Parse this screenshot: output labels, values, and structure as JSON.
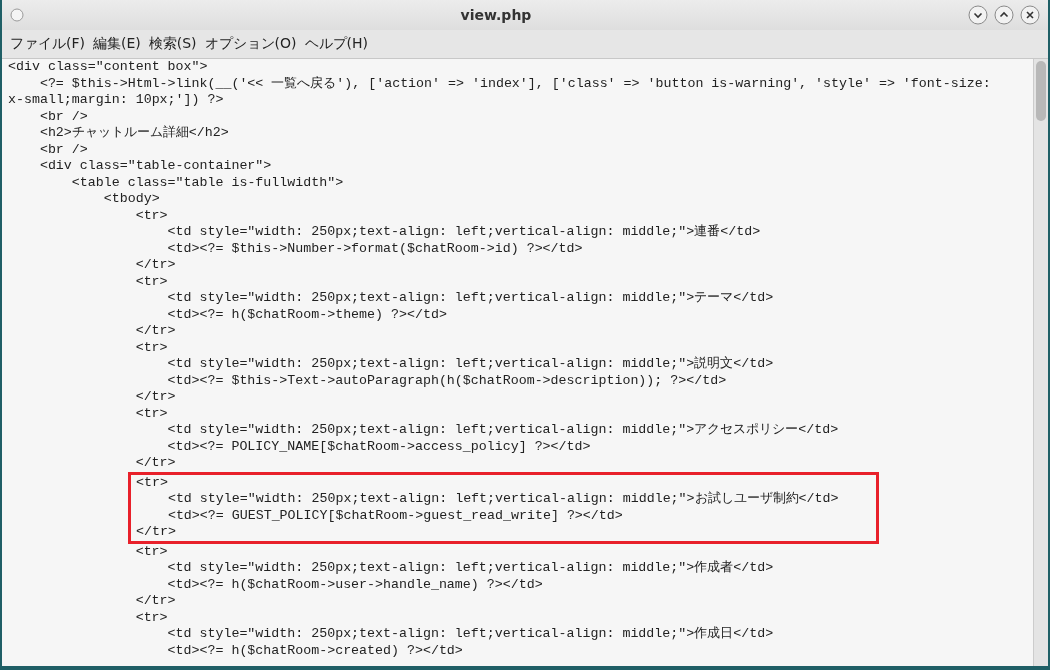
{
  "window": {
    "title": "view.php"
  },
  "menu": [
    "ファイル(F)",
    "編集(E)",
    "検索(S)",
    "オプション(O)",
    "ヘルプ(H)"
  ],
  "editor": {
    "lines": [
      {
        "text": "<div class=\"content box\">",
        "boxed": false
      },
      {
        "text": "    <?= $this->Html->link(__('<< 一覧へ戻る'), ['action' => 'index'], ['class' => 'button is-warning', 'style' => 'font-size: x-small;margin: 10px;']) ?>",
        "boxed": false
      },
      {
        "text": "    <br />",
        "boxed": false
      },
      {
        "text": "    <h2>チャットルーム詳細</h2>",
        "boxed": false
      },
      {
        "text": "    <br />",
        "boxed": false
      },
      {
        "text": "    <div class=\"table-container\">",
        "boxed": false
      },
      {
        "text": "        <table class=\"table is-fullwidth\">",
        "boxed": false
      },
      {
        "text": "            <tbody>",
        "boxed": false
      },
      {
        "text": "                <tr>",
        "boxed": false
      },
      {
        "text": "                    <td style=\"width: 250px;text-align: left;vertical-align: middle;\">連番</td>",
        "boxed": false
      },
      {
        "text": "                    <td><?= $this->Number->format($chatRoom->id) ?></td>",
        "boxed": false
      },
      {
        "text": "                </tr>",
        "boxed": false
      },
      {
        "text": "                <tr>",
        "boxed": false
      },
      {
        "text": "                    <td style=\"width: 250px;text-align: left;vertical-align: middle;\">テーマ</td>",
        "boxed": false
      },
      {
        "text": "                    <td><?= h($chatRoom->theme) ?></td>",
        "boxed": false
      },
      {
        "text": "                </tr>",
        "boxed": false
      },
      {
        "text": "                <tr>",
        "boxed": false
      },
      {
        "text": "                    <td style=\"width: 250px;text-align: left;vertical-align: middle;\">説明文</td>",
        "boxed": false
      },
      {
        "text": "                    <td><?= $this->Text->autoParagraph(h($chatRoom->description)); ?></td>",
        "boxed": false
      },
      {
        "text": "                </tr>",
        "boxed": false
      },
      {
        "text": "                <tr>",
        "boxed": false
      },
      {
        "text": "                    <td style=\"width: 250px;text-align: left;vertical-align: middle;\">アクセスポリシー</td>",
        "boxed": false
      },
      {
        "text": "                    <td><?= POLICY_NAME[$chatRoom->access_policy] ?></td>",
        "boxed": false
      },
      {
        "text": "                </tr>",
        "boxed": false
      },
      {
        "text": "                <tr>",
        "boxed": true
      },
      {
        "text": "                    <td style=\"width: 250px;text-align: left;vertical-align: middle;\">お試しユーザ制約</td>",
        "boxed": true
      },
      {
        "text": "                    <td><?= GUEST_POLICY[$chatRoom->guest_read_write] ?></td>",
        "boxed": true
      },
      {
        "text": "                </tr>",
        "boxed": true
      },
      {
        "text": "                <tr>",
        "boxed": false
      },
      {
        "text": "                    <td style=\"width: 250px;text-align: left;vertical-align: middle;\">作成者</td>",
        "boxed": false
      },
      {
        "text": "                    <td><?= h($chatRoom->user->handle_name) ?></td>",
        "boxed": false
      },
      {
        "text": "                </tr>",
        "boxed": false
      },
      {
        "text": "                <tr>",
        "boxed": false
      },
      {
        "text": "                    <td style=\"width: 250px;text-align: left;vertical-align: middle;\">作成日</td>",
        "boxed": false
      },
      {
        "text": "                    <td><?= h($chatRoom->created) ?></td>",
        "boxed": false
      }
    ]
  }
}
